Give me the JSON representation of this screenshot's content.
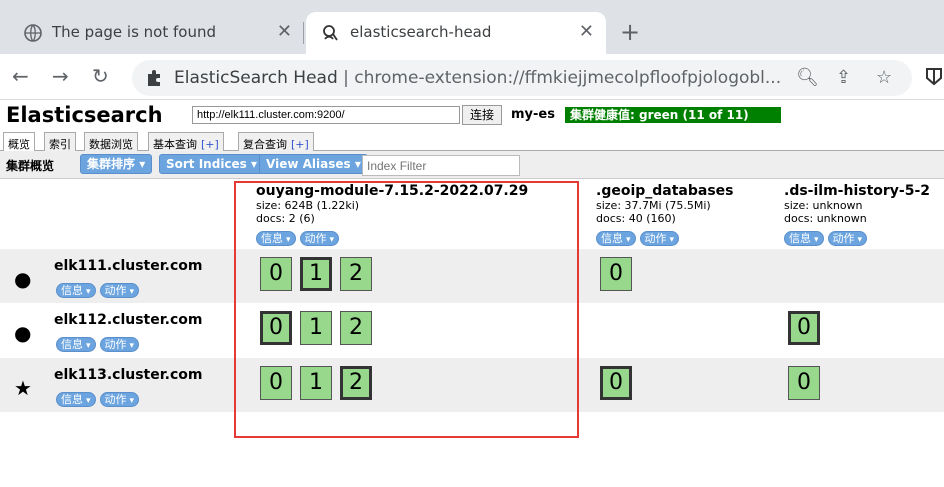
{
  "browser": {
    "tabs": [
      {
        "label": "The page is not found",
        "active": false
      },
      {
        "label": "elasticsearch-head",
        "active": true
      }
    ],
    "omnibox": {
      "site": "ElasticSearch Head",
      "separator": "|",
      "url": "chrome-extension://ffmkiejjmecolpfloofpjologobl..."
    }
  },
  "header": {
    "title": "Elasticsearch",
    "cluster_url": "http://elk111.cluster.com:9200/",
    "connect_label": "连接",
    "cluster_name": "my-es",
    "health": "集群健康值: green (11 of 11)",
    "health_color": "#008000"
  },
  "nav_tabs": [
    {
      "label": "概览",
      "plus": ""
    },
    {
      "label": "索引",
      "plus": ""
    },
    {
      "label": "数据浏览",
      "plus": ""
    },
    {
      "label": "基本查询",
      "plus": "[+]"
    },
    {
      "label": "复合查询",
      "plus": "[+]"
    }
  ],
  "subbar": {
    "title": "集群概览",
    "sort_cluster": "集群排序",
    "sort_indices": "Sort Indices",
    "view_aliases": "View Aliases",
    "filter_placeholder": "Index Filter"
  },
  "pills": {
    "info": "信息",
    "action": "动作"
  },
  "indices": [
    {
      "name": "ouyang-module-7.15.2-2022.07.29",
      "size": "size: 624B (1.22ki)",
      "docs": "docs: 2 (6)"
    },
    {
      "name": ".geoip_databases",
      "size": "size: 37.7Mi (75.5Mi)",
      "docs": "docs: 40 (160)"
    },
    {
      "name": ".ds-ilm-history-5-2",
      "size": "size: unknown",
      "docs": "docs: unknown"
    }
  ],
  "nodes": [
    {
      "name": "elk111.cluster.com",
      "symbol": "●"
    },
    {
      "name": "elk112.cluster.com",
      "symbol": "●"
    },
    {
      "name": "elk113.cluster.com",
      "symbol": "★"
    }
  ],
  "shards": {
    "row0": [
      "0",
      "1",
      "2",
      "0"
    ],
    "row1": [
      "0",
      "1",
      "2",
      "0"
    ],
    "row2": [
      "0",
      "1",
      "2",
      "0",
      "0"
    ]
  },
  "colors": {
    "shard_green": "#98d88c",
    "pill_blue": "#6ba4de",
    "highlight_red": "#e53935"
  }
}
